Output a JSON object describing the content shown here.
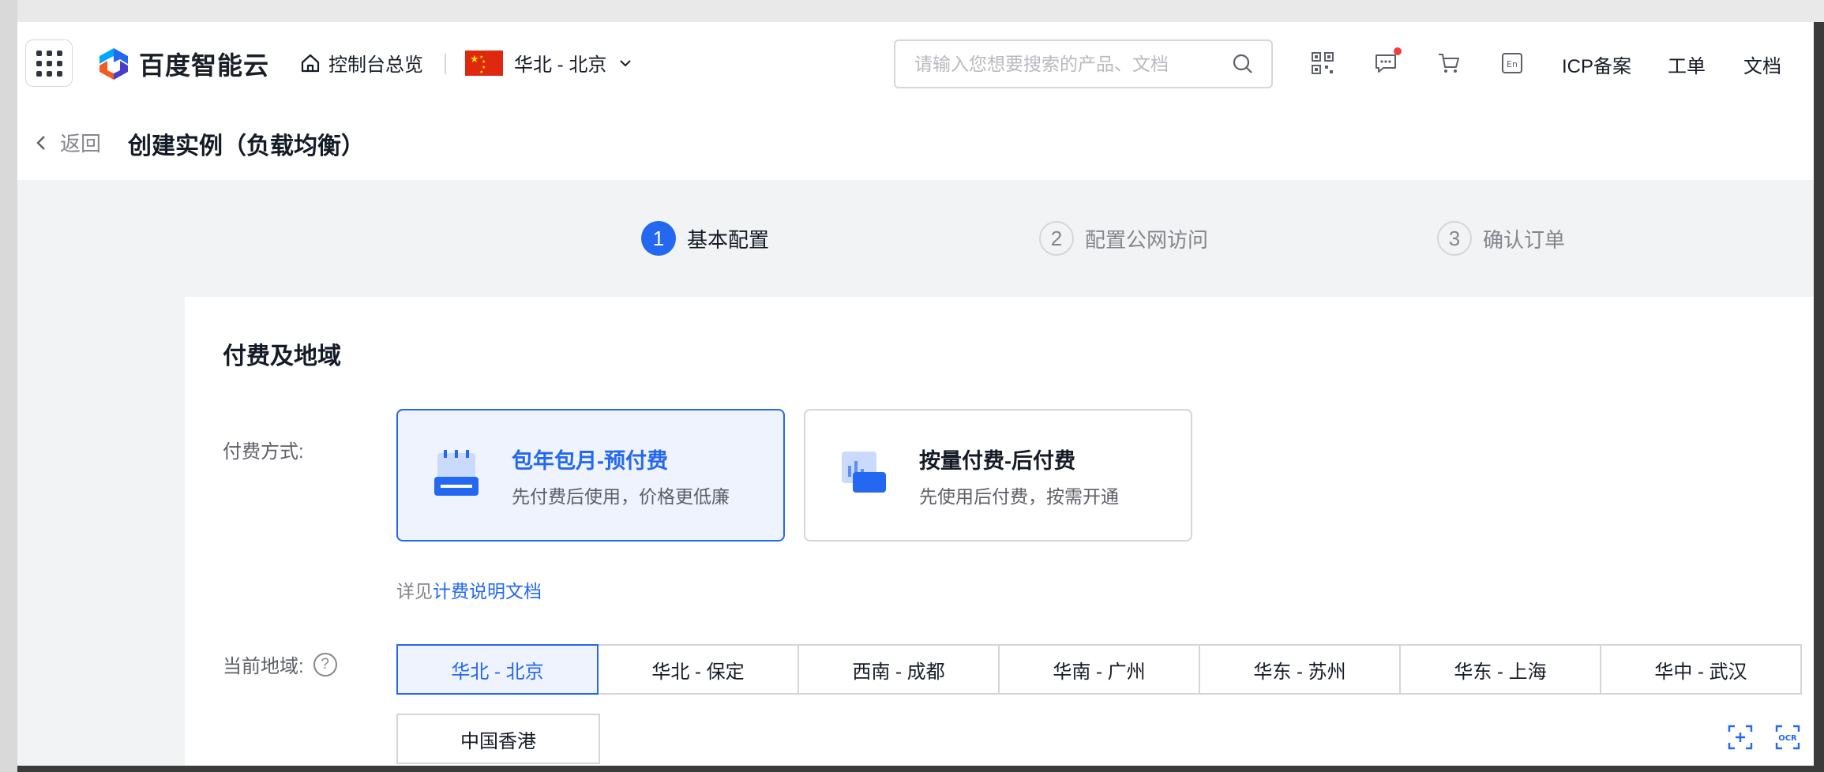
{
  "logo": {
    "text": "百度智能云"
  },
  "nav": {
    "home_label": "控制台总览",
    "region_label": "华北 - 北京",
    "search_placeholder": "请输入您想要搜索的产品、文档",
    "links": {
      "icp": "ICP备案",
      "ticket": "工单",
      "docs": "文档"
    },
    "icons": [
      "qrcode-icon",
      "message-icon",
      "cart-icon",
      "language-en-icon"
    ]
  },
  "subheader": {
    "back_label": "返回",
    "title": "创建实例（负载均衡）"
  },
  "steps": [
    {
      "num": "1",
      "label": "基本配置",
      "active": true
    },
    {
      "num": "2",
      "label": "配置公网访问",
      "active": false
    },
    {
      "num": "3",
      "label": "确认订单",
      "active": false
    }
  ],
  "section": {
    "title": "付费及地域",
    "pay_label": "付费方式:",
    "pay_options": [
      {
        "title": "包年包月-预付费",
        "desc": "先付费后使用，价格更低廉",
        "selected": true
      },
      {
        "title": "按量付费-后付费",
        "desc": "先使用后付费，按需开通",
        "selected": false
      }
    ],
    "doc_prefix": "详见",
    "doc_link": "计费说明文档",
    "region_label": "当前地域:",
    "help_char": "?",
    "regions": [
      "华北 - 北京",
      "华北 - 保定",
      "西南 - 成都",
      "华南 - 广州",
      "华东 - 苏州",
      "华东 - 上海",
      "华中 - 武汉"
    ],
    "region_extra": "中国香港",
    "selected_region": "华北 - 北京"
  },
  "colors": {
    "accent": "#2468f2",
    "selected_bg": "#eef3fe",
    "notify": "#f33e3e"
  }
}
